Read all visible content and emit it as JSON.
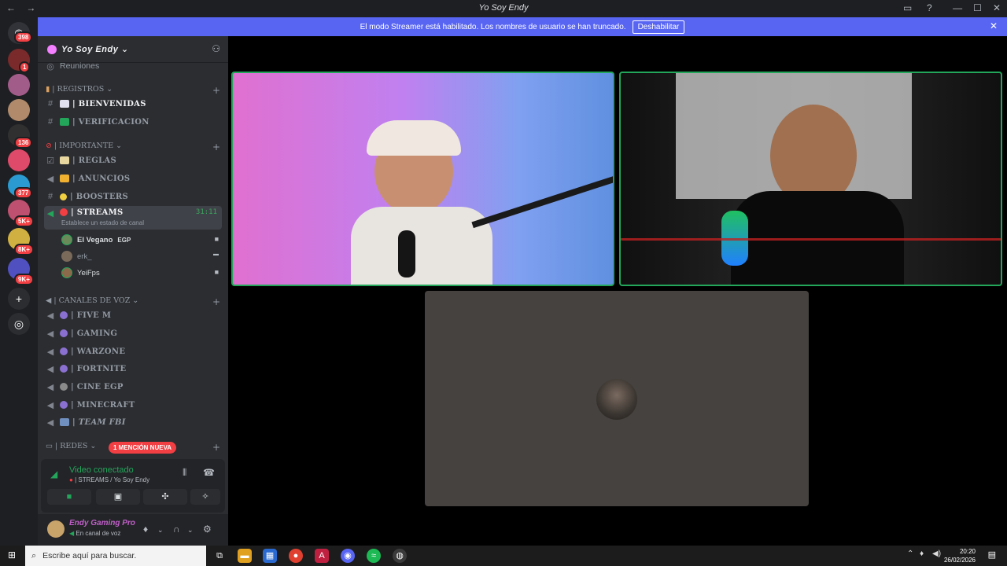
{
  "window": {
    "title": "Yo Soy Endy",
    "back": "←",
    "forward": "→",
    "min": "—",
    "max": "☐",
    "close": "✕"
  },
  "guild_badges": [
    "398",
    "1",
    "136",
    "377",
    "5K+",
    "8K+",
    "9K+"
  ],
  "banner": {
    "text": "El modo Streamer está habilitado. Los nombres de usuario se han truncado.",
    "button": "Deshabilitar"
  },
  "server": {
    "name": "Yo Soy Endy",
    "chevron": "⌄"
  },
  "channels": {
    "reuniones": "Reuniones",
    "cat_registros": "| REGISTROS ⌄",
    "bienvenidas": "| BIENVENIDAS",
    "verificacion": "| VERIFICACION",
    "cat_importante": "| IMPORTANTE ⌄",
    "reglas": "| REGLAS",
    "anuncios": "| ANUNCIOS",
    "boosters": "| BOOSTERS",
    "streams": "| STREAMS",
    "streams_timer": "31:11",
    "streams_status": "Establece un estado de canal",
    "cat_voz": "| CANALES DE VOZ ⌄",
    "fivem": "| FIVE M",
    "gaming": "|  GAMING",
    "warzone": "| WARZONE",
    "fortnite": "| FORTNITE",
    "cine": "| CINE EGP",
    "minecraft": "| MINECRAFT",
    "teamfbi": "| TEAM FBI",
    "cat_redes": "| REDES ⌄",
    "mention": "1 MENCIÓN NUEVA",
    "plus": "+"
  },
  "voice_users": [
    {
      "name": "El Vegano",
      "tag": "EGP"
    },
    {
      "name": "erk_"
    },
    {
      "name": "YeiFps"
    }
  ],
  "voice_panel": {
    "status": "Video conectado",
    "channel": "| STREAMS / Yo Soy Endy"
  },
  "user_panel": {
    "name": "Endy Gaming Pro",
    "status": "En canal de voz"
  },
  "taskbar": {
    "search_placeholder": "Escribe aquí para buscar.",
    "time": "20:20",
    "date": "26/02/2026"
  },
  "colors": {
    "accent": "#5865f2",
    "speaking": "#23a55a",
    "danger": "#f23f43"
  }
}
